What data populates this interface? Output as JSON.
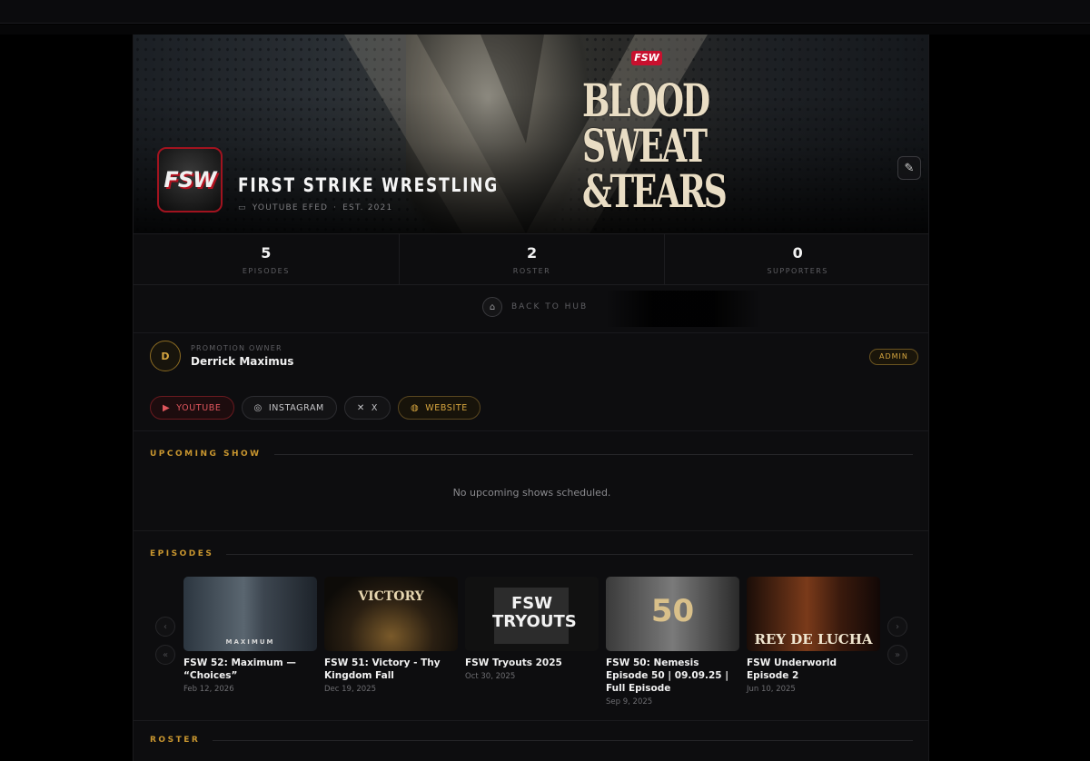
{
  "promotion": {
    "name": "FIRST STRIKE WRESTLING",
    "type": "YOUTUBE EFED",
    "established": "EST. 2021",
    "logo_text": "FSW",
    "banner_title_lines": [
      "BLOOD",
      "SWEAT",
      "&TEARS"
    ],
    "banner_logo": "FSW"
  },
  "stats": [
    {
      "value": "5",
      "label": "EPISODES"
    },
    {
      "value": "2",
      "label": "ROSTER"
    },
    {
      "value": "0",
      "label": "SUPPORTERS"
    }
  ],
  "back_label": "BACK TO HUB",
  "owner": {
    "initial": "D",
    "role_label": "PROMOTION OWNER",
    "name": "Derrick Maximus",
    "badge": "ADMIN"
  },
  "socials": {
    "youtube": "YOUTUBE",
    "instagram": "INSTAGRAM",
    "x": "X",
    "website": "WEBSITE"
  },
  "upcoming": {
    "heading": "UPCOMING SHOW",
    "empty_text": "No upcoming shows scheduled."
  },
  "episodes": {
    "heading": "EPISODES",
    "items": [
      {
        "title": "FSW 52: Maximum — “Choices”",
        "date": "Feb 12, 2026",
        "thumb_text": "MAXIMUM"
      },
      {
        "title": "FSW 51: Victory - Thy Kingdom Fall",
        "date": "Dec 19, 2025",
        "thumb_text": "VICTORY"
      },
      {
        "title": "FSW Tryouts 2025",
        "date": "Oct 30, 2025",
        "thumb_text": "FSW TRYOUTS"
      },
      {
        "title": "FSW 50: Nemesis Episode 50 | 09.09.25 | Full Episode",
        "date": "Sep 9, 2025",
        "thumb_text": "50"
      },
      {
        "title": "FSW Underworld Episode 2",
        "date": "Jun 10, 2025",
        "thumb_text": "REY DE LUCHA"
      }
    ]
  },
  "roster": {
    "heading": "ROSTER"
  },
  "colors": {
    "accent_gold": "#c9962f",
    "youtube_red": "#e0565d",
    "brand_red": "#c8102e"
  }
}
